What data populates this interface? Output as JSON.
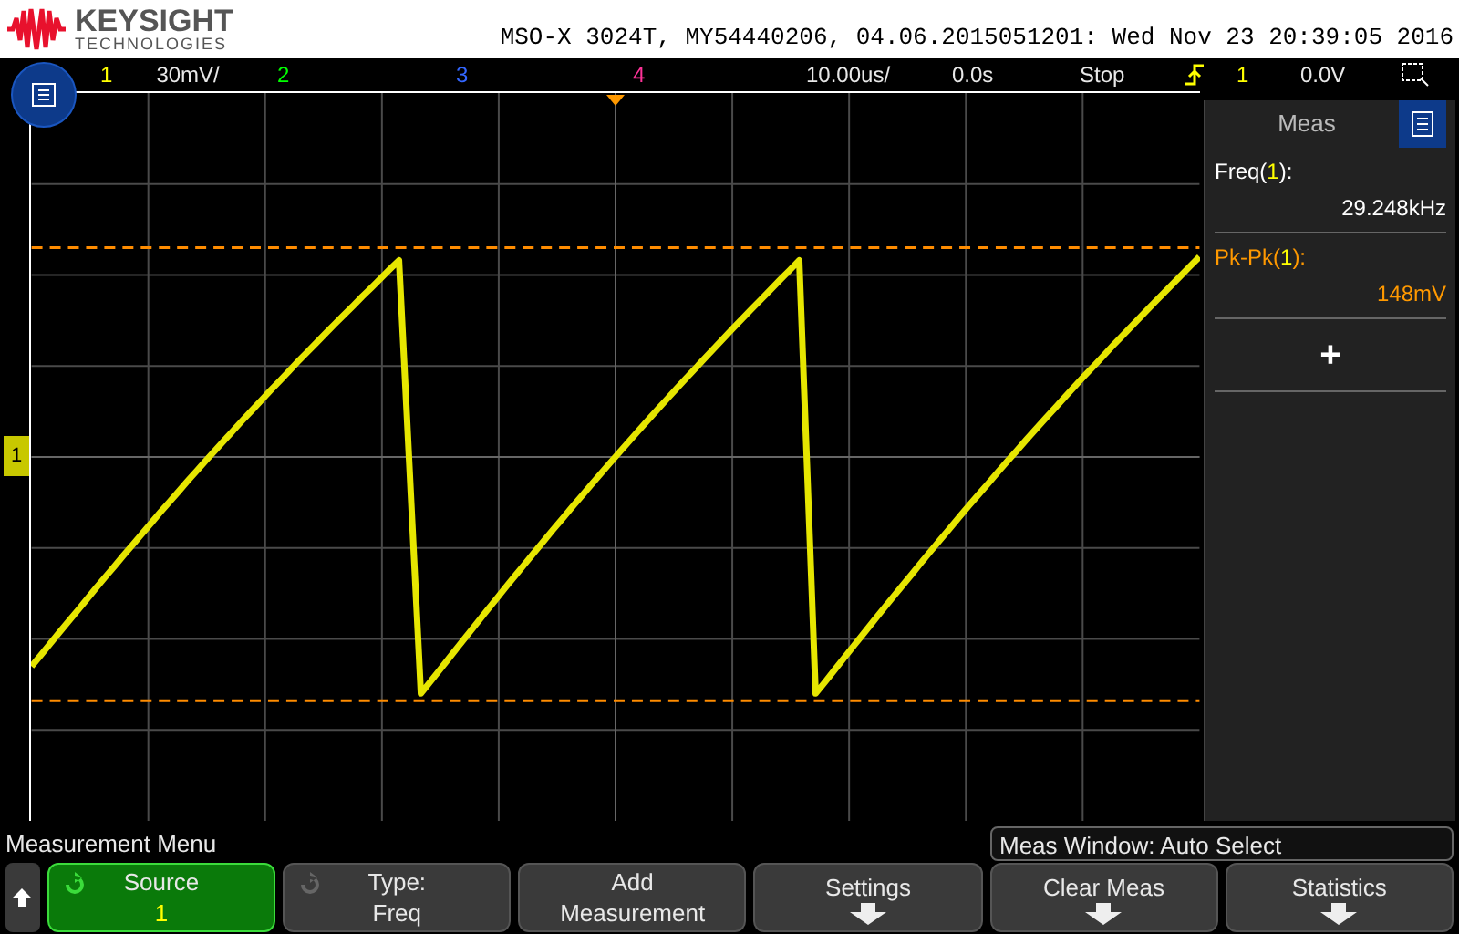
{
  "header": {
    "brand": "KEYSIGHT",
    "brand_sub": "TECHNOLOGIES",
    "title": "MSO-X 3024T, MY54440206, 04.06.2015051201: Wed Nov 23 20:39:05 2016"
  },
  "status_bar": {
    "channels": [
      {
        "label": "1",
        "color": "#ffff00",
        "scale": "30mV/"
      },
      {
        "label": "2",
        "color": "#00ff00"
      },
      {
        "label": "3",
        "color": "#3366ff"
      },
      {
        "label": "4",
        "color": "#ff3399"
      }
    ],
    "timebase": "10.00us/",
    "delay": "0.0s",
    "run_state": "Stop",
    "trigger_source": "1",
    "trigger_level": "0.0V"
  },
  "display": {
    "channel_marker": "1"
  },
  "meas_panel": {
    "title": "Meas",
    "measurements": [
      {
        "parts": [
          "Freq(",
          "1",
          "):"
        ],
        "value": "29.248kHz",
        "color": "#ffffff"
      },
      {
        "parts": [
          "Pk-Pk(",
          "1",
          "):"
        ],
        "value": "148mV",
        "color": "#ff9900"
      }
    ],
    "add": "+"
  },
  "menu": {
    "title": "Measurement Menu",
    "meas_window": "Meas Window: Auto Select",
    "softkeys": [
      {
        "kind": "knob",
        "lines": [
          "Source",
          "1"
        ],
        "selected": true
      },
      {
        "kind": "knob",
        "lines": [
          "Type:",
          "Freq"
        ],
        "selected": false
      },
      {
        "kind": "plain",
        "lines": [
          "Add",
          "Measurement"
        ],
        "selected": false
      },
      {
        "kind": "arrow",
        "lines": [
          "Settings"
        ],
        "selected": false
      },
      {
        "kind": "arrow",
        "lines": [
          "Clear Meas"
        ],
        "selected": false
      },
      {
        "kind": "arrow",
        "lines": [
          "Statistics"
        ],
        "selected": false
      }
    ]
  }
}
